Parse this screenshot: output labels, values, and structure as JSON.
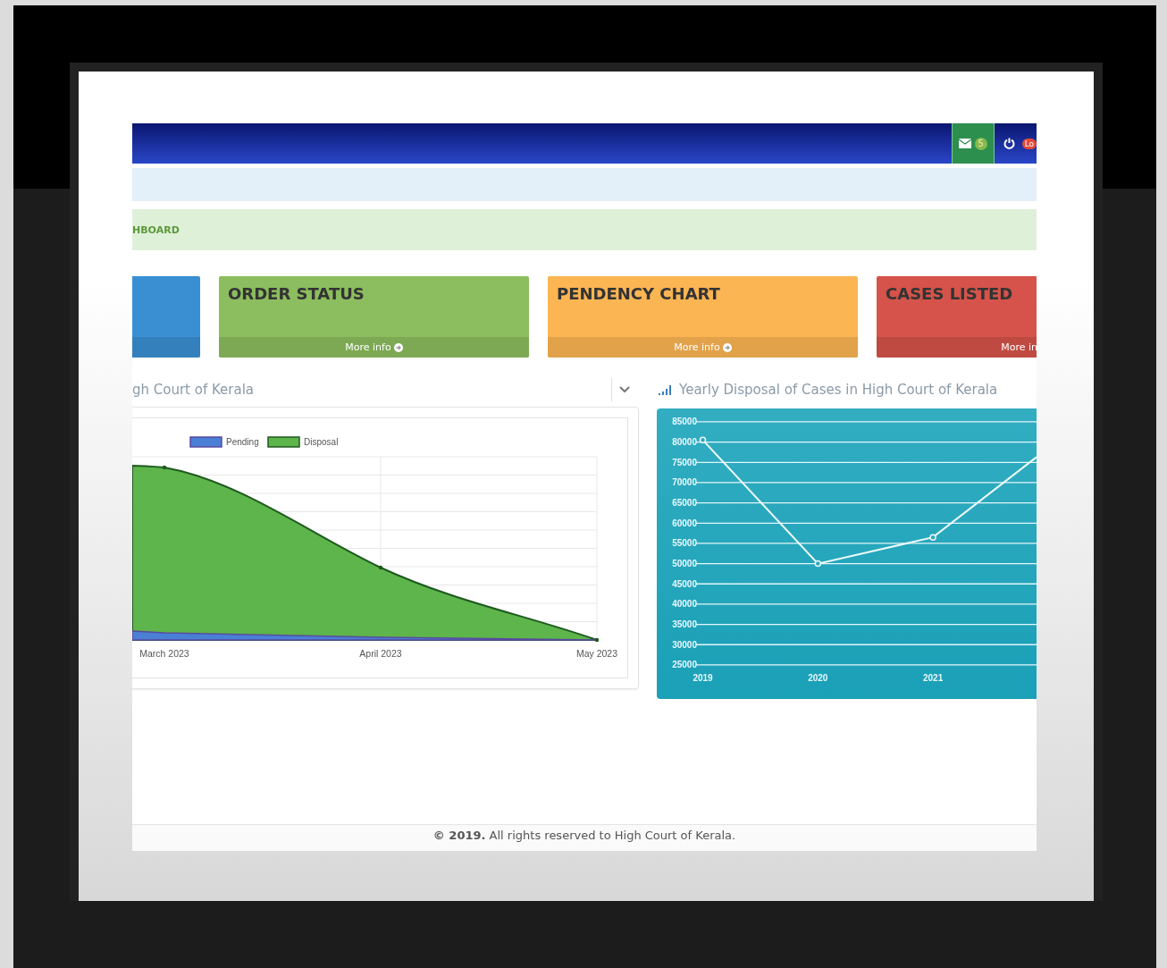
{
  "top_bar": {
    "mail_count": "5",
    "logout_badge": "Lo"
  },
  "breadcrumb": "HBOARD",
  "cards": [
    {
      "color": "#3a8fd2"
    },
    {
      "title": "ORDER STATUS",
      "link": "More info",
      "color": "#8cbd5e",
      "icon": true
    },
    {
      "title": "PENDENCY CHART",
      "link": "More info",
      "color": "#fbb553",
      "icon": true
    },
    {
      "title": "CASES LISTED",
      "link": "More in",
      "color": "#d5534a",
      "icon": false
    }
  ],
  "left_panel": {
    "title": "gh Court of Kerala",
    "legend": [
      {
        "label": "Pending",
        "color": "#4a7fd6"
      },
      {
        "label": "Disposal",
        "color": "#5db54b"
      }
    ],
    "x_labels": [
      "March 2023",
      "April 2023",
      "May 2023"
    ]
  },
  "right_panel": {
    "title": "Yearly Disposal of Cases in High Court of Kerala",
    "chart_data": {
      "type": "line",
      "x": [
        2019,
        2020,
        2021,
        2021.9
      ],
      "values": [
        80500,
        50000,
        56500,
        76300
      ],
      "xticks": [
        2019,
        2020,
        2021
      ],
      "xlim": [
        2018.6,
        2021.9
      ],
      "grid": true,
      "ylim": [
        16600,
        88300
      ],
      "yticks": [
        25000,
        30000,
        35000,
        40000,
        45000,
        50000,
        55000,
        60000,
        65000,
        70000,
        75000,
        80000,
        85000
      ]
    }
  },
  "footer": "**© 2019.** All rights reserved to High Court of Kerala."
}
